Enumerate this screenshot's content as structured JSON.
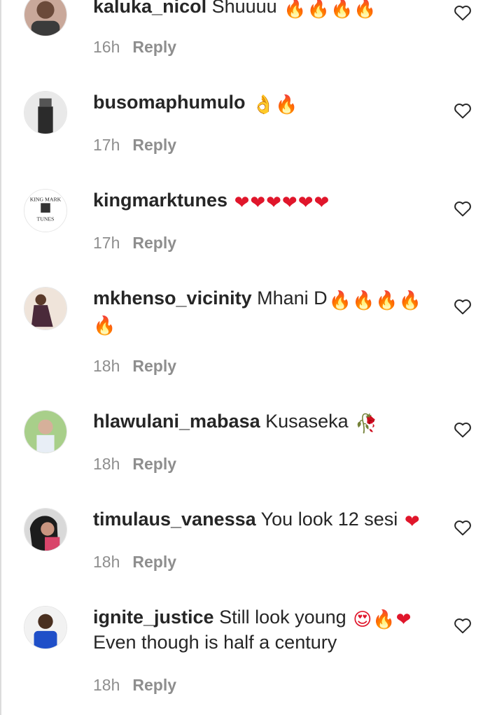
{
  "comments": [
    {
      "username": "kaluka_nicol",
      "text": "Shuuuu",
      "emoji": "🔥🔥🔥🔥",
      "emoji_kind": "fire",
      "time": "16h",
      "reply": "Reply"
    },
    {
      "username": "busomaphumulo",
      "text": "",
      "emoji": "👌🔥",
      "emoji_kind": "fire",
      "time": "17h",
      "reply": "Reply"
    },
    {
      "username": "kingmarktunes",
      "text": "",
      "emoji": "❤❤❤❤❤❤",
      "emoji_kind": "heart",
      "time": "17h",
      "reply": "Reply",
      "avatar_text": "KING MARK",
      "avatar_text2": "TUNES"
    },
    {
      "username": "mkhenso_vicinity",
      "text": "Mhani D",
      "emoji": "🔥🔥🔥🔥",
      "emoji_kind": "fire",
      "emoji2": "🔥",
      "time": "18h",
      "reply": "Reply"
    },
    {
      "username": "hlawulani_mabasa",
      "text": "Kusaseka",
      "emoji": "🥀",
      "emoji_kind": "heart",
      "time": "18h",
      "reply": "Reply"
    },
    {
      "username": "timulaus_vanessa",
      "text": "You look 12 sesi",
      "emoji": "❤",
      "emoji_kind": "heart",
      "time": "18h",
      "reply": "Reply"
    },
    {
      "username": "ignite_justice",
      "text": "Still look young",
      "emoji": "😍🔥❤",
      "emoji_kind": "heart",
      "line2": "Even though is half a century",
      "time": "18h",
      "reply": "Reply"
    }
  ],
  "icons": {
    "like": "heart-outline-icon"
  },
  "colors": {
    "text": "#262626",
    "meta": "#8e8e8e",
    "fire": "#f0691a",
    "heart": "#e0162b"
  }
}
